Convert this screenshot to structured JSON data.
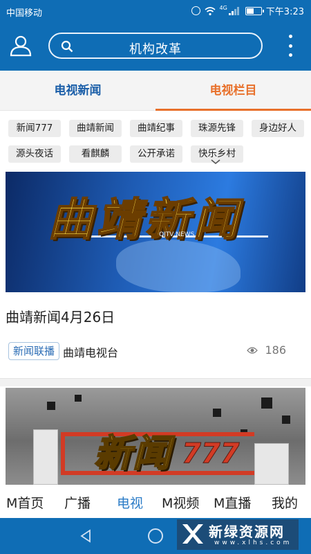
{
  "status_bar": {
    "carrier": "中国移动",
    "network_tag": "4G",
    "time": "下午3:23",
    "battery_level": 0.5
  },
  "header": {
    "search_text": "机构改革",
    "user_icon": "user-icon",
    "search_icon": "search-icon",
    "more_icon": "more-vertical-icon"
  },
  "tabs": [
    {
      "label": "电视新闻",
      "active": false
    },
    {
      "label": "电视栏目",
      "active": true
    }
  ],
  "chips": [
    "新闻777",
    "曲靖新闻",
    "曲靖纪事",
    "珠源先锋",
    "身边好人",
    "源头夜话",
    "看麒麟",
    "公开承诺",
    "快乐乡村"
  ],
  "feed": [
    {
      "thumb_logo": "曲靖新闻",
      "thumb_sub": "QJTV NEWS",
      "title": "曲靖新闻4月26日",
      "tag": "新闻联播",
      "source": "曲靖电视台",
      "views": "186"
    },
    {
      "thumb_logo": "新闻",
      "thumb_num": "777"
    }
  ],
  "bottom_nav": [
    {
      "label": "M首页",
      "active": false
    },
    {
      "label": "广播",
      "active": false
    },
    {
      "label": "电视",
      "active": true
    },
    {
      "label": "M视频",
      "active": false
    },
    {
      "label": "M直播",
      "active": false
    },
    {
      "label": "我的",
      "active": false
    }
  ],
  "watermark": {
    "title": "新绿资源网",
    "url": "www.xlhs.com"
  },
  "colors": {
    "brand_blue": "#0f6db5",
    "active_orange": "#e8702a",
    "active_nav": "#2b7cc7"
  }
}
